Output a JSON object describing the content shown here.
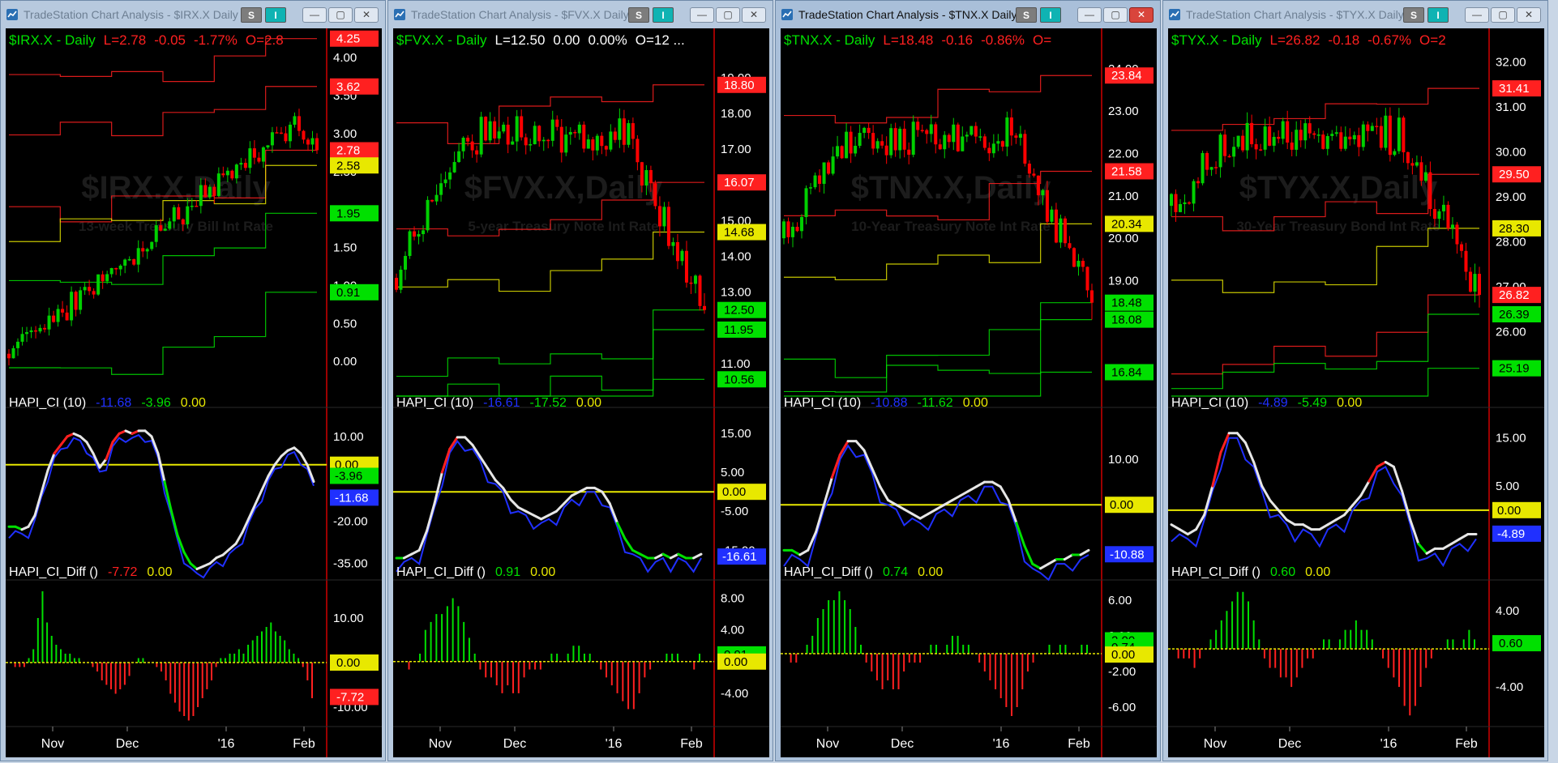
{
  "app": {
    "minimize": "—",
    "maximize": "▢",
    "close": "✕",
    "s_button": "S",
    "i_button": "I"
  },
  "colors": {
    "green": "#00e000",
    "red": "#ff2020",
    "yellow": "#e8e800",
    "blue": "#2030ff",
    "white": "#e6e6e6",
    "grey": "#5a5a5a",
    "price_red": "#ff0000",
    "price_green": "#00d000"
  },
  "panels": [
    {
      "title": "TradeStation Chart Analysis - $IRX.X Daily [...",
      "active": false,
      "price_header": {
        "symbol": "$IRX.X - Daily",
        "last": "L=2.78",
        "chg": "-0.05",
        "pct": "-1.77%",
        "open": "O=2.8",
        "color": "#ff2020"
      },
      "watermark": {
        "symbol": "$IRX.X,Daily",
        "desc": "13-week Treasury Bill Int Rate"
      },
      "chart_data": {
        "type": "candlestick",
        "ylim": [
          -0.5,
          4.3
        ],
        "yticks": [
          "4.00",
          "3.50",
          "3.00",
          "2.50",
          "2.00",
          "1.50",
          "1.00",
          "0.50",
          "0.00"
        ],
        "ytick_values": [
          4.0,
          3.5,
          3.0,
          2.5,
          2.0,
          1.5,
          1.0,
          0.5,
          0.0
        ],
        "start": 0.1,
        "end": 2.78,
        "wiggle": 0.18,
        "count": 70,
        "trend": "up",
        "levels": [
          {
            "label": "4.25",
            "value": 4.25,
            "color": "#ff2020"
          },
          {
            "label": "3.62",
            "value": 3.62,
            "color": "#ff2020"
          },
          {
            "label": "2.78",
            "value": 2.78,
            "color": "#ff2020"
          },
          {
            "label": "2.58",
            "value": 2.58,
            "color": "#e8e800"
          },
          {
            "label": "1.95",
            "value": 1.95,
            "color": "#00e000"
          },
          {
            "label": "0.91",
            "value": 0.91,
            "color": "#00e000"
          }
        ]
      },
      "ci": {
        "header": {
          "name": "HAPI_CI (10)",
          "v1": "-11.68",
          "v2": "-3.96",
          "v3": "0.00"
        },
        "ylim": [
          -40,
          18
        ],
        "yticks": [
          "10.00",
          "-20.00",
          "-35.00"
        ],
        "ytick_values": [
          10,
          -20,
          -35
        ],
        "zero": 0,
        "tags": [
          {
            "label": "0.00",
            "value": 0.0,
            "color": "#e8e800"
          },
          {
            "label": "-3.96",
            "value": -3.96,
            "color": "#00e000"
          },
          {
            "label": "-11.68",
            "value": -11.68,
            "color": "#2030ff"
          }
        ],
        "points": [
          -22,
          -22,
          -23,
          -22,
          -18,
          -10,
          -2,
          4,
          7,
          10,
          11,
          10,
          8,
          4,
          -1,
          2,
          8,
          11,
          12,
          11,
          12,
          12,
          10,
          4,
          -6,
          -16,
          -25,
          -31,
          -35,
          -37,
          -36,
          -35,
          -33,
          -32,
          -30,
          -28,
          -24,
          -19,
          -14,
          -9,
          -4,
          0,
          3,
          5,
          6,
          4,
          0,
          -6
        ],
        "blue_offset": 2.5
      },
      "diff": {
        "header": {
          "name": "HAPI_CI_Diff ()",
          "v1": "-7.72",
          "v2": "0.00"
        },
        "ylim": [
          -14,
          18
        ],
        "yticks": [
          "10.00",
          "-10.00"
        ],
        "ytick_values": [
          10,
          -10
        ],
        "tags": [
          {
            "label": "0.00",
            "value": 0.0,
            "color": "#e8e800"
          },
          {
            "label": "-7.72",
            "value": -7.72,
            "color": "#ff2020"
          }
        ],
        "bars": [
          0,
          -1,
          -1,
          -1,
          1,
          3,
          10,
          16,
          9,
          6,
          4,
          3,
          2,
          2,
          1,
          1,
          0,
          0,
          -1,
          -2,
          -4,
          -5,
          -6,
          -7,
          -6,
          -5,
          -3,
          0,
          1,
          1,
          0,
          0,
          -1,
          -2,
          -4,
          -7,
          -9,
          -11,
          -12,
          -13,
          -12,
          -10,
          -8,
          -6,
          -4,
          -1,
          1,
          1,
          2,
          2,
          3,
          2,
          4,
          5,
          6,
          7,
          8,
          9,
          7,
          6,
          5,
          3,
          2,
          1,
          -1,
          -4,
          -8
        ]
      },
      "xticks": [
        "Nov",
        "Dec",
        "'16",
        "Feb"
      ]
    },
    {
      "title": "TradeStation Chart Analysis - $FVX.X Daily [...",
      "active": false,
      "price_header": {
        "symbol": "$FVX.X - Daily",
        "last": "L=12.50",
        "chg": "0.00",
        "pct": "0.00%",
        "open": "O=12 ...",
        "color": "#ffffff"
      },
      "watermark": {
        "symbol": "$FVX.X,Daily",
        "desc": "5-year Treasury Note Int Rate"
      },
      "chart_data": {
        "type": "candlestick",
        "ylim": [
          10.0,
          20.2
        ],
        "yticks": [
          "19.00",
          "18.00",
          "17.00",
          "16.00",
          "15.00",
          "14.00",
          "13.00",
          "12.00",
          "11.00"
        ],
        "ytick_values": [
          19,
          18,
          17,
          16,
          15,
          14,
          13,
          12,
          11
        ],
        "start": 13.4,
        "end": 12.5,
        "wiggle": 0.5,
        "count": 70,
        "trend": "humpdown",
        "levels": [
          {
            "label": "18.80",
            "value": 18.8,
            "color": "#ff2020"
          },
          {
            "label": "16.07",
            "value": 16.07,
            "color": "#ff2020"
          },
          {
            "label": "14.68",
            "value": 14.68,
            "color": "#e8e800"
          },
          {
            "label": "12.50",
            "value": 12.5,
            "color": "#00e000"
          },
          {
            "label": "11.95",
            "value": 11.95,
            "color": "#00e000"
          },
          {
            "label": "10.56",
            "value": 10.56,
            "color": "#00e000"
          }
        ]
      },
      "ci": {
        "header": {
          "name": "HAPI_CI (10)",
          "v1": "-16.61",
          "v2": "-17.52",
          "v3": "0.00"
        },
        "ylim": [
          -22,
          20
        ],
        "yticks": [
          "15.00",
          "5.00",
          "-5.00",
          "-15.00"
        ],
        "ytick_values": [
          15,
          5,
          -5,
          -15
        ],
        "zero": 0,
        "tags": [
          {
            "label": "0.00",
            "value": 0.0,
            "color": "#e8e800"
          },
          {
            "label": "-16.61",
            "value": -16.61,
            "color": "#2030ff"
          }
        ],
        "points": [
          -17,
          -17,
          -16,
          -15,
          -10,
          -3,
          5,
          11,
          14,
          14,
          12,
          9,
          6,
          3,
          1,
          -2,
          -4,
          -5,
          -6,
          -7,
          -6,
          -5,
          -3,
          -1,
          0,
          1,
          1,
          0,
          -3,
          -8,
          -12,
          -15,
          -16,
          -17,
          -17,
          -16,
          -17,
          -16,
          -17,
          -17,
          -16
        ],
        "blue_offset": 2.0
      },
      "diff": {
        "header": {
          "name": "HAPI_CI_Diff ()",
          "v1": "0.91",
          "v2": "0.00"
        },
        "ylim": [
          -8,
          10
        ],
        "yticks": [
          "8.00",
          "4.00",
          "-4.00"
        ],
        "ytick_values": [
          8,
          4,
          -4
        ],
        "tags": [
          {
            "label": "0.91",
            "value": 0.91,
            "color": "#00e000"
          },
          {
            "label": "0.00",
            "value": 0.0,
            "color": "#e8e800"
          }
        ],
        "bars": [
          0,
          0,
          -1,
          0,
          1,
          4,
          5,
          6,
          6,
          7,
          8,
          7,
          5,
          3,
          1,
          -1,
          -2,
          -2,
          -3,
          -4,
          -3,
          -4,
          -4,
          -2,
          -1,
          -1,
          -1,
          0,
          1,
          1,
          0,
          1,
          2,
          2,
          1,
          1,
          0,
          -1,
          -2,
          -3,
          -4,
          -5,
          -6,
          -6,
          -4,
          -2,
          -1,
          0,
          0,
          1,
          1,
          1,
          0,
          0,
          -1,
          1
        ]
      },
      "xticks": [
        "Nov",
        "Dec",
        "'16",
        "Feb"
      ]
    },
    {
      "title": "TradeStation Chart Analysis - $TNX.X Daily [...",
      "active": true,
      "price_header": {
        "symbol": "$TNX.X - Daily",
        "last": "L=18.48",
        "chg": "-0.16",
        "pct": "-0.86%",
        "open": "O=",
        "color": "#ff2020"
      },
      "watermark": {
        "symbol": "$TNX.X,Daily",
        "desc": "10-Year Treasury Note Int Rate"
      },
      "chart_data": {
        "type": "candlestick",
        "ylim": [
          16.2,
          24.8
        ],
        "yticks": [
          "24.00",
          "23.00",
          "22.00",
          "21.00",
          "20.00",
          "19.00"
        ],
        "ytick_values": [
          24,
          23,
          22,
          21,
          20,
          19
        ],
        "start": 20.0,
        "end": 18.48,
        "wiggle": 0.4,
        "count": 70,
        "trend": "humpdown",
        "levels": [
          {
            "label": "23.84",
            "value": 23.84,
            "color": "#ff2020"
          },
          {
            "label": "21.58",
            "value": 21.58,
            "color": "#ff2020"
          },
          {
            "label": "20.34",
            "value": 20.34,
            "color": "#e8e800"
          },
          {
            "label": "18.48",
            "value": 18.48,
            "color": "#00e000"
          },
          {
            "label": "18.08",
            "value": 18.08,
            "color": "#00e000"
          },
          {
            "label": "16.84",
            "value": 16.84,
            "color": "#00e000"
          }
        ]
      },
      "ci": {
        "header": {
          "name": "HAPI_CI (10)",
          "v1": "-10.88",
          "v2": "-11.62",
          "v3": "0.00"
        },
        "ylim": [
          -16,
          20
        ],
        "yticks": [
          "10.00",
          "0.00"
        ],
        "ytick_values": [
          10,
          0
        ],
        "zero": 0,
        "tags": [
          {
            "label": "0.00",
            "value": 0.0,
            "color": "#e8e800"
          },
          {
            "label": "-10.88",
            "value": -10.88,
            "color": "#2030ff"
          }
        ],
        "points": [
          -10,
          -10,
          -11,
          -10,
          -6,
          0,
          6,
          11,
          14,
          14,
          12,
          8,
          4,
          1,
          0,
          -1,
          -2,
          -3,
          -2,
          -1,
          0,
          1,
          2,
          3,
          4,
          5,
          5,
          4,
          1,
          -4,
          -9,
          -13,
          -14,
          -13,
          -12,
          -12,
          -11,
          -11,
          -10
        ],
        "blue_offset": 2.0
      },
      "diff": {
        "header": {
          "name": "HAPI_CI_Diff ()",
          "v1": "0.74",
          "v2": "0.00"
        },
        "ylim": [
          -8,
          8
        ],
        "yticks": [
          "6.00",
          "2.00",
          "-2.00",
          "-6.00"
        ],
        "ytick_values": [
          6,
          2,
          -2,
          -6
        ],
        "tags": [
          {
            "label": "2.00",
            "value": 1.5,
            "color": "#00e000"
          },
          {
            "label": "0.74",
            "value": 0.74,
            "color": "#00e000"
          },
          {
            "label": "0.00",
            "value": -0.1,
            "color": "#e8e800"
          }
        ],
        "bars": [
          0,
          -1,
          -1,
          0,
          1,
          2,
          4,
          5,
          6,
          6,
          7,
          6,
          5,
          3,
          1,
          -1,
          -2,
          -3,
          -4,
          -3,
          -4,
          -4,
          -2,
          -1,
          -1,
          -1,
          0,
          1,
          1,
          0,
          1,
          2,
          2,
          1,
          1,
          0,
          -1,
          -2,
          -3,
          -4,
          -5,
          -6,
          -7,
          -6,
          -4,
          -2,
          -1,
          0,
          0,
          1,
          0,
          1,
          1,
          0,
          0,
          1,
          1
        ]
      },
      "xticks": [
        "Nov",
        "Dec",
        "'16",
        "Feb"
      ]
    },
    {
      "title": "TradeStation Chart Analysis - $TYX.X Daily [...",
      "active": false,
      "price_header": {
        "symbol": "$TYX.X - Daily",
        "last": "L=26.82",
        "chg": "-0.18",
        "pct": "-0.67%",
        "open": "O=2",
        "color": "#ff2020"
      },
      "watermark": {
        "symbol": "$TYX.X,Daily",
        "desc": "30-Year Treasury Bond Int Rate"
      },
      "chart_data": {
        "type": "candlestick",
        "ylim": [
          24.5,
          32.6
        ],
        "yticks": [
          "32.00",
          "31.00",
          "30.00",
          "29.00",
          "28.00",
          "27.00",
          "26.00"
        ],
        "ytick_values": [
          32,
          31,
          30,
          29,
          28,
          27,
          26
        ],
        "start": 28.8,
        "end": 26.82,
        "wiggle": 0.4,
        "count": 70,
        "trend": "humpdown",
        "levels": [
          {
            "label": "31.41",
            "value": 31.41,
            "color": "#ff2020"
          },
          {
            "label": "29.50",
            "value": 29.5,
            "color": "#ff2020"
          },
          {
            "label": "28.30",
            "value": 28.3,
            "color": "#e8e800"
          },
          {
            "label": "26.82",
            "value": 26.82,
            "color": "#ff2020"
          },
          {
            "label": "26.39",
            "value": 26.39,
            "color": "#00e000"
          },
          {
            "label": "25.19",
            "value": 25.19,
            "color": "#00e000"
          }
        ]
      },
      "ci": {
        "header": {
          "name": "HAPI_CI (10)",
          "v1": "-4.89",
          "v2": "-5.49",
          "v3": "0.00"
        },
        "ylim": [
          -14,
          20
        ],
        "yticks": [
          "15.00",
          "5.00",
          "-5.00"
        ],
        "ytick_values": [
          15,
          5,
          -5
        ],
        "zero": 0,
        "tags": [
          {
            "label": "0.00",
            "value": 0.0,
            "color": "#e8e800"
          },
          {
            "label": "-4.89",
            "value": -4.89,
            "color": "#2030ff"
          }
        ],
        "points": [
          -3,
          -4,
          -5,
          -4,
          -1,
          5,
          12,
          16,
          16,
          14,
          10,
          5,
          2,
          0,
          -2,
          -3,
          -3,
          -4,
          -4,
          -3,
          -2,
          -1,
          1,
          3,
          6,
          9,
          10,
          9,
          4,
          -2,
          -7,
          -9,
          -8,
          -8,
          -7,
          -6,
          -5,
          -5
        ],
        "blue_offset": 2.0
      },
      "diff": {
        "header": {
          "name": "HAPI_CI_Diff ()",
          "v1": "0.60",
          "v2": "0.00"
        },
        "ylim": [
          -8,
          7
        ],
        "yticks": [
          "4.00",
          "-4.00"
        ],
        "ytick_values": [
          4,
          -4
        ],
        "tags": [
          {
            "label": "0.60",
            "value": 0.6,
            "color": "#00e000"
          }
        ],
        "bars": [
          0,
          -1,
          -1,
          -1,
          -2,
          -1,
          0,
          1,
          2,
          3,
          4,
          5,
          6,
          6,
          5,
          3,
          1,
          -1,
          -2,
          -2,
          -3,
          -3,
          -4,
          -3,
          -2,
          -1,
          -1,
          0,
          1,
          1,
          0,
          1,
          2,
          2,
          3,
          2,
          2,
          1,
          0,
          -1,
          -2,
          -3,
          -4,
          -6,
          -7,
          -6,
          -4,
          -2,
          -1,
          0,
          0,
          1,
          1,
          0,
          1,
          2,
          1
        ]
      },
      "xticks": [
        "Nov",
        "Dec",
        "'16",
        "Feb"
      ]
    }
  ]
}
